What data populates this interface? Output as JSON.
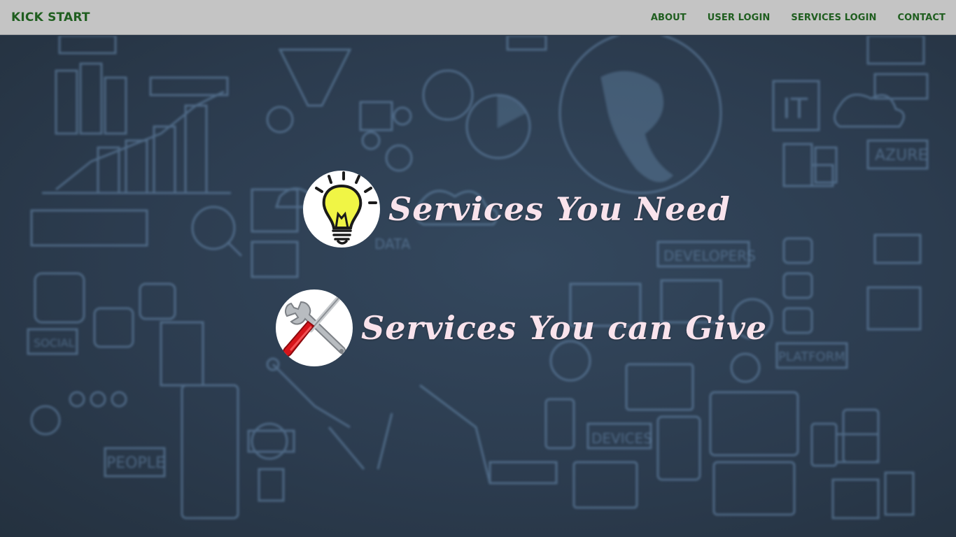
{
  "navbar": {
    "brand": "KICK START",
    "links": [
      {
        "label": "ABOUT"
      },
      {
        "label": "USER LOGIN"
      },
      {
        "label": "SERVICES LOGIN"
      },
      {
        "label": "CONTACT"
      }
    ]
  },
  "services": [
    {
      "label": "Services You Need",
      "icon": "lightbulb-icon"
    },
    {
      "label": "Services You can Give",
      "icon": "tools-icon"
    }
  ],
  "background_decoration": {
    "labels": [
      "IT",
      "AZURE",
      "DEVELOPERS",
      "DEVICES",
      "PLATFORM",
      "PEOPLE",
      "SOCIAL",
      "DATA"
    ]
  },
  "colors": {
    "navbar_bg": "#c4c4c4",
    "nav_text": "#1f5e1f",
    "page_bg": "#2c3c4f",
    "service_text": "#f9e3ec",
    "bulb_yellow": "#f0f545",
    "screwdriver_red": "#d7141a"
  }
}
